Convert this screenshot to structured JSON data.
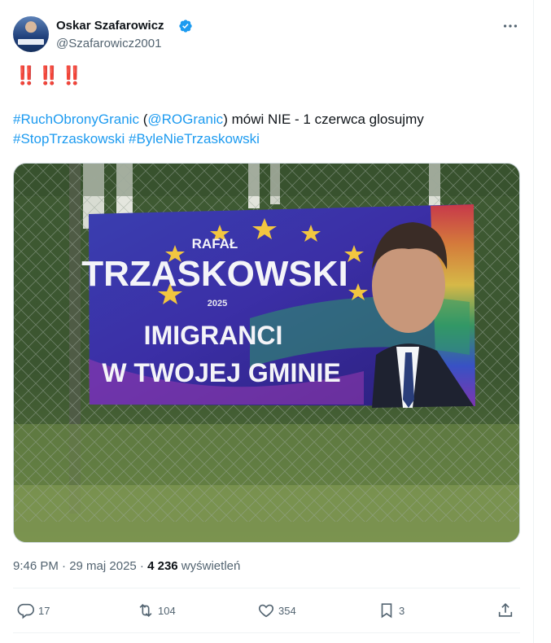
{
  "author": {
    "name": "Oskar Szafarowicz",
    "handle": "@Szafarowicz2001"
  },
  "tweet": {
    "emphasis": "‼️‼️‼️",
    "hashtag1": "#RuchObronyGranic",
    "open_paren": " (",
    "mention": "@ROGranic",
    "text_rest": ") mówi NIE - 1 czerwca glosujmy",
    "hashtag2": "#StopTrzaskowski",
    "hashtag3": "#ByleNieTrzaskowski"
  },
  "media": {
    "banner_firstname": "RAFAŁ",
    "banner_surname": "TRZASKOWSKI",
    "banner_year": "2025",
    "banner_line1": "IMIGRANCI",
    "banner_line2": "W TWOJEJ GMINIE"
  },
  "meta": {
    "time_date": "9:46 PM · 29 maj 2025 · ",
    "views_count": "4 236",
    "views_label": " wyświetleń"
  },
  "actions": {
    "replies": "17",
    "reposts": "104",
    "likes": "354",
    "bookmarks": "3"
  },
  "colors": {
    "link": "#1d9bf0",
    "secondary_text": "#536471",
    "verified": "#1d9bf0",
    "emphasis": "#d11f2e"
  }
}
